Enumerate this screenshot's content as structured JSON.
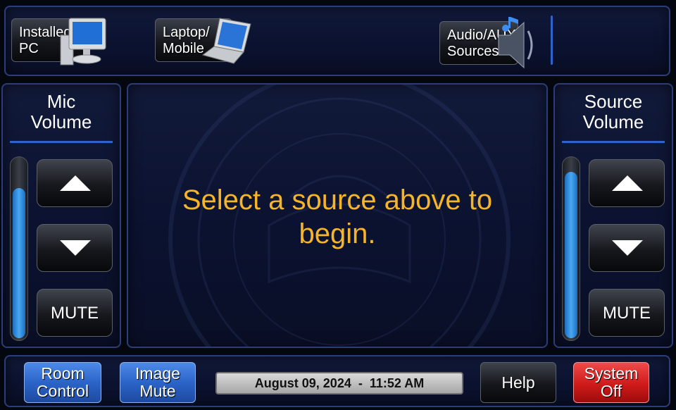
{
  "sources": [
    {
      "label": "Installed\nPC",
      "icon": "desktop-pc-icon"
    },
    {
      "label": "Laptop/\nMobile",
      "icon": "laptop-icon"
    },
    {
      "label": "Audio/AUX\nSources",
      "icon": "speaker-music-icon"
    }
  ],
  "mic_volume": {
    "title": "Mic\nVolume",
    "level": 0.84,
    "up_icon": "triangle-up-icon",
    "down_icon": "triangle-down-icon",
    "mute_label": "MUTE"
  },
  "source_volume": {
    "title": "Source\nVolume",
    "level": 0.93,
    "up_icon": "triangle-up-icon",
    "down_icon": "triangle-down-icon",
    "mute_label": "MUTE"
  },
  "prompt": "Select a source above to\nbegin.",
  "bottom": {
    "room_control": "Room\nControl",
    "image_mute": "Image\nMute",
    "datetime": "August 09, 2024  -  11:52 AM",
    "help": "Help",
    "system_off": "System\nOff"
  },
  "colors": {
    "accent_blue": "#2f63c9",
    "prompt_text": "#f6b429",
    "meter_fill": "#48a8f2",
    "system_off": "#cf1a1a"
  }
}
